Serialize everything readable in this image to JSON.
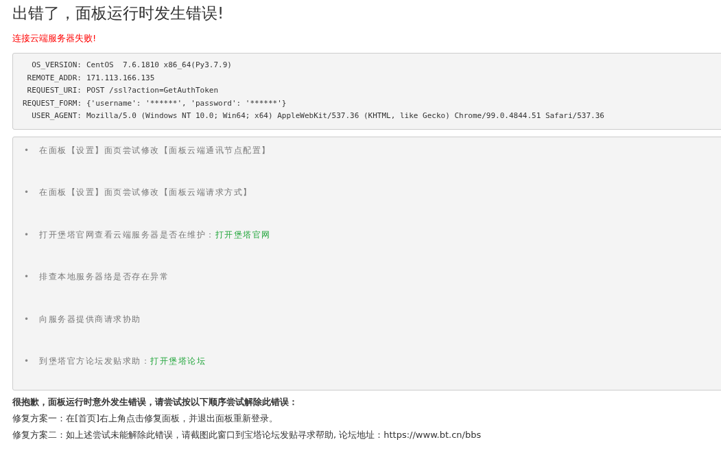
{
  "title": "出错了，面板运行时发生错误!",
  "error_message": "连接云端服务器失败!",
  "details": [
    {
      "label": "OS_VERSION:",
      "value": "CentOS  7.6.1810 x86_64(Py3.7.9)"
    },
    {
      "label": "REMOTE_ADDR:",
      "value": "171.113.166.135"
    },
    {
      "label": "REQUEST_URI:",
      "value": "POST /ssl?action=GetAuthToken"
    },
    {
      "label": "REQUEST_FORM:",
      "value": "{'username': '******', 'password': '******'}"
    },
    {
      "label": "USER_AGENT:",
      "value": "Mozilla/5.0 (Windows NT 10.0; Win64; x64) AppleWebKit/537.36 (KHTML, like Gecko) Chrome/99.0.4844.51 Safari/537.36"
    }
  ],
  "suggestions": [
    {
      "bullet": "•",
      "text": "在面板【设置】面页尝试修改【面板云端通讯节点配置】"
    },
    {
      "bullet": "•",
      "text": "在面板【设置】面页尝试修改【面板云端请求方式】"
    },
    {
      "bullet": "•",
      "text": "打开堡塔官网查看云端服务器是否在维护：",
      "link": "打开堡塔官网"
    },
    {
      "bullet": "•",
      "text": "排查本地服务器络是否存在异常"
    },
    {
      "bullet": "•",
      "text": "向服务器提供商请求协助"
    },
    {
      "bullet": "•",
      "text": "到堡塔官方论坛发贴求助：",
      "link": "打开堡塔论坛"
    }
  ],
  "apology": "很抱歉，面板运行时意外发生错误，请尝试按以下顺序尝试解除此错误：",
  "fixes": [
    "修复方案一：在[首页]右上角点击修复面板，并退出面板重新登录。",
    "修复方案二：如上述尝试未能解除此错误，请截图此窗口到宝塔论坛发贴寻求帮助, 论坛地址：https://www.bt.cn/bbs"
  ]
}
